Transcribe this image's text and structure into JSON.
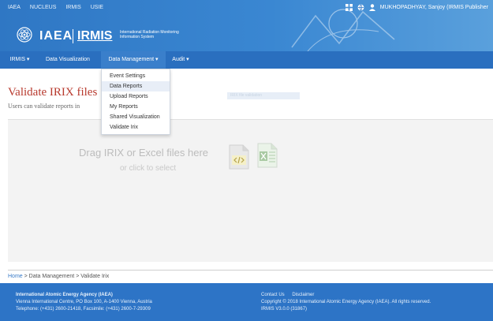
{
  "topbar": {
    "links": [
      "IAEA",
      "NUCLEUS",
      "IRMIS",
      "USIE"
    ],
    "logo_iaea": "IAEA",
    "logo_irmis": "IRMIS",
    "logo_subtitle": "International Radiation Monitoring Information System",
    "user_name": "MUKHOPADHYAY, Sanjoy (IRMIS Publisher"
  },
  "nav": {
    "items": [
      "IRMIS ▾",
      "Data Visualization",
      "Data Management ▾",
      "Audit ▾"
    ]
  },
  "dropdown": {
    "items": [
      "Event Settings",
      "Data Reports",
      "Upload Reports",
      "My Reports",
      "Shared Visualization",
      "Validate Irix"
    ]
  },
  "main": {
    "title": "Validate IRIX files",
    "subtitle": "Users can validate reports in",
    "filter_placeholder": "IRIX file validation"
  },
  "dropzone": {
    "main_text": "Drag IRIX or Excel files here",
    "sub_text": "or click to select"
  },
  "breadcrumb": {
    "home": "Home",
    "rest": " > Data Management > Validate Irix"
  },
  "footer": {
    "org_name": "International Atomic Energy Agency (IAEA)",
    "address": "Vienna International Centre, PO Box 100, A-1400 Vienna, Austria",
    "phone": "Telephone: (+431) 2600-21418, Facsimile: (+431) 2600-7-29309",
    "contact": "Contact Us",
    "disclaimer": "Disclaimer",
    "copyright": "Copyright © 2018 International Atomic Energy Agency (IAEA). All rights reserved.",
    "version": "IRMIS V3.0.0 (31867)"
  },
  "colors": {
    "header_blue": "#2f77c4",
    "nav_blue": "#2a6fbf",
    "title_red": "#b83a2e",
    "footer_blue": "#2d74c6"
  }
}
